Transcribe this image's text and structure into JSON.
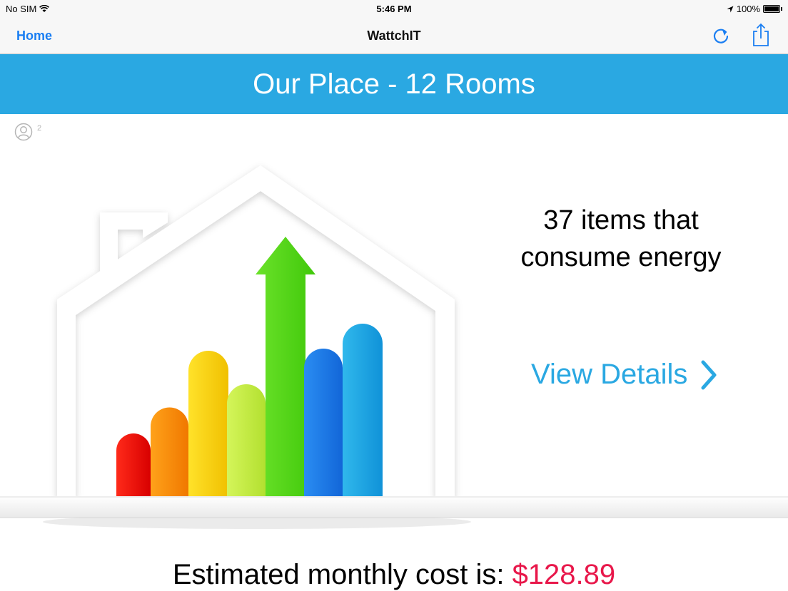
{
  "status_bar": {
    "carrier": "No SIM",
    "time": "5:46 PM",
    "battery": "100%"
  },
  "nav": {
    "back_label": "Home",
    "title": "WattchIT",
    "refresh_icon": "refresh-icon",
    "share_icon": "share-icon"
  },
  "banner": {
    "title": "Our Place - 12 Rooms"
  },
  "users": {
    "icon": "user-icon",
    "count": "2"
  },
  "summary": {
    "items_text": "37 items that\nconsume energy",
    "view_details": "View Details"
  },
  "cost": {
    "label": "Estimated monthly cost is: ",
    "value": "$128.89"
  },
  "colors": {
    "accent": "#2aa8e2",
    "link": "#1a7ef2",
    "cost": "#e8174a"
  }
}
